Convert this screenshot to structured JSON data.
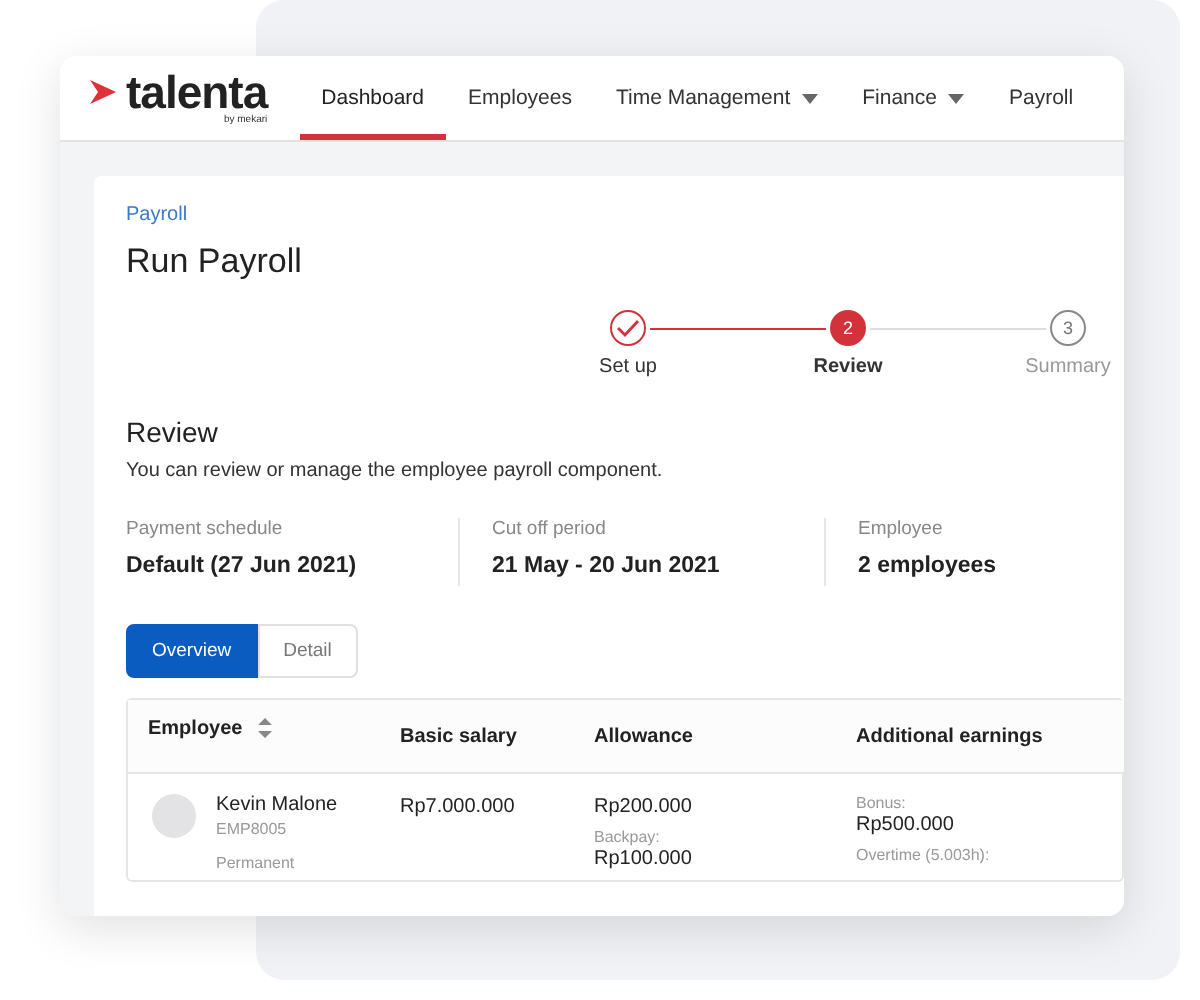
{
  "logo": {
    "name": "talenta",
    "byline": "by mekari"
  },
  "nav": [
    {
      "label": "Dashboard",
      "selected": true,
      "dropdown": false
    },
    {
      "label": "Employees",
      "selected": false,
      "dropdown": false
    },
    {
      "label": "Time Management",
      "selected": false,
      "dropdown": true
    },
    {
      "label": "Finance",
      "selected": false,
      "dropdown": true
    },
    {
      "label": "Payroll",
      "selected": false,
      "dropdown": false
    }
  ],
  "breadcrumb": "Payroll",
  "title": "Run Payroll",
  "steps": [
    {
      "label": "Set up",
      "completed": true,
      "selected": false
    },
    {
      "number": "2",
      "label": "Review",
      "completed": false,
      "selected": true
    },
    {
      "number": "3",
      "label": "Summary",
      "completed": false,
      "selected": false
    }
  ],
  "review": {
    "title": "Review",
    "description": "You can review or manage the employee payroll component."
  },
  "summary": [
    {
      "label": "Payment schedule",
      "value": "Default (27 Jun 2021)"
    },
    {
      "label": "Cut off period",
      "value": "21 May - 20 Jun 2021"
    },
    {
      "label": "Employee",
      "value": "2 employees"
    }
  ],
  "view_tabs": [
    {
      "label": "Overview",
      "selected": true
    },
    {
      "label": "Detail",
      "selected": false
    }
  ],
  "table": {
    "columns": [
      {
        "label": "Employee",
        "sortable": true
      },
      {
        "label": "Basic salary",
        "sortable": false
      },
      {
        "label": "Allowance",
        "sortable": false
      },
      {
        "label": "Additional earnings",
        "sortable": false
      }
    ],
    "rows": [
      {
        "cells": [
          {
            "kind": "employee",
            "name": "Kevin Malone",
            "id": "EMP8005",
            "type": "Permanent"
          },
          {
            "kind": "amounts",
            "entries": [
              {
                "value": "Rp7.000.000"
              }
            ]
          },
          {
            "kind": "amounts",
            "entries": [
              {
                "value": "Rp200.000"
              },
              {
                "label": "Backpay:",
                "value": "Rp100.000"
              }
            ]
          },
          {
            "kind": "amounts",
            "entries": [
              {
                "label": "Bonus:",
                "value": "Rp500.000"
              },
              {
                "label": "Overtime (5.003h):"
              }
            ]
          }
        ]
      }
    ]
  }
}
